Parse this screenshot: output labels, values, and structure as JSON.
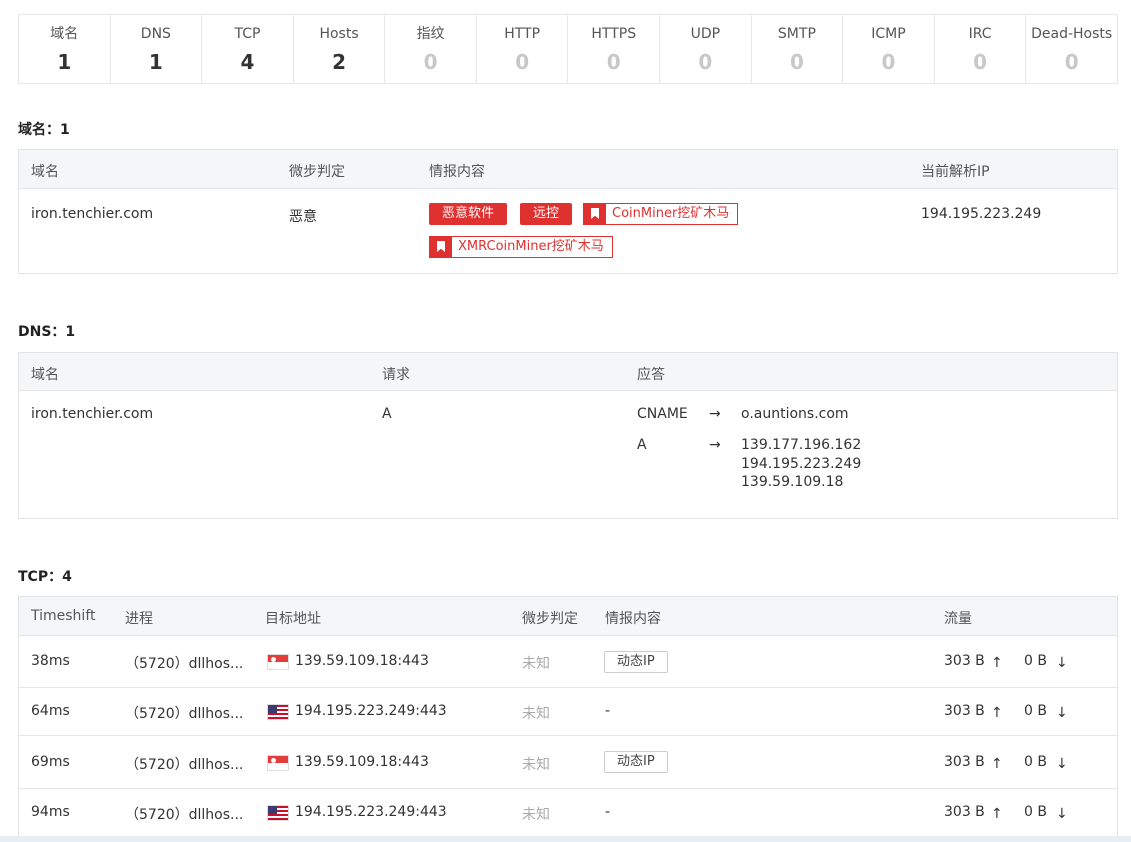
{
  "stats": [
    {
      "label": "域名",
      "value": "1"
    },
    {
      "label": "DNS",
      "value": "1"
    },
    {
      "label": "TCP",
      "value": "4"
    },
    {
      "label": "Hosts",
      "value": "2"
    },
    {
      "label": "指纹",
      "value": "0"
    },
    {
      "label": "HTTP",
      "value": "0"
    },
    {
      "label": "HTTPS",
      "value": "0"
    },
    {
      "label": "UDP",
      "value": "0"
    },
    {
      "label": "SMTP",
      "value": "0"
    },
    {
      "label": "ICMP",
      "value": "0"
    },
    {
      "label": "IRC",
      "value": "0"
    },
    {
      "label": "Dead-Hosts",
      "value": "0"
    }
  ],
  "domains": {
    "title": "域名：1",
    "headers": {
      "domain": "域名",
      "verdict": "微步判定",
      "intel": "情报内容",
      "ip": "当前解析IP"
    },
    "row": {
      "domain": "iron.tenchier.com",
      "verdict": "恶意",
      "tags": [
        "恶意软件",
        "远控"
      ],
      "tags_bookmark": [
        "CoinMiner挖矿木马",
        "XMRCoinMiner挖矿木马"
      ],
      "ip": "194.195.223.249"
    }
  },
  "dns": {
    "title": "DNS：1",
    "headers": {
      "domain": "域名",
      "request": "请求",
      "answer": "应答"
    },
    "row": {
      "domain": "iron.tenchier.com",
      "request": "A",
      "answers": [
        {
          "type": "CNAME",
          "arrow": "→",
          "values": [
            "o.auntions.com"
          ]
        },
        {
          "type": "A",
          "arrow": "→",
          "values": [
            "139.177.196.162",
            "194.195.223.249",
            "139.59.109.18"
          ]
        }
      ]
    }
  },
  "tcp": {
    "title": "TCP：4",
    "headers": {
      "timeshift": "Timeshift",
      "process": "进程",
      "target": "目标地址",
      "verdict": "微步判定",
      "intel": "情报内容",
      "traffic": "流量"
    },
    "rows": [
      {
        "timeshift": "38ms",
        "process": "（5720）dllhos...",
        "flag": "sg",
        "target": "139.59.109.18:443",
        "verdict": "未知",
        "intel": "动态IP",
        "intel_type": "button",
        "up": "303 B",
        "down": "0 B"
      },
      {
        "timeshift": "64ms",
        "process": "（5720）dllhos...",
        "flag": "us",
        "target": "194.195.223.249:443",
        "verdict": "未知",
        "intel": "-",
        "intel_type": "text",
        "up": "303 B",
        "down": "0 B"
      },
      {
        "timeshift": "69ms",
        "process": "（5720）dllhos...",
        "flag": "sg",
        "target": "139.59.109.18:443",
        "verdict": "未知",
        "intel": "动态IP",
        "intel_type": "button",
        "up": "303 B",
        "down": "0 B"
      },
      {
        "timeshift": "94ms",
        "process": "（5720）dllhos...",
        "flag": "us",
        "target": "194.195.223.249:443",
        "verdict": "未知",
        "intel": "-",
        "intel_type": "text",
        "up": "303 B",
        "down": "0 B"
      }
    ],
    "up_arrow": "↑",
    "down_arrow": "↓"
  }
}
